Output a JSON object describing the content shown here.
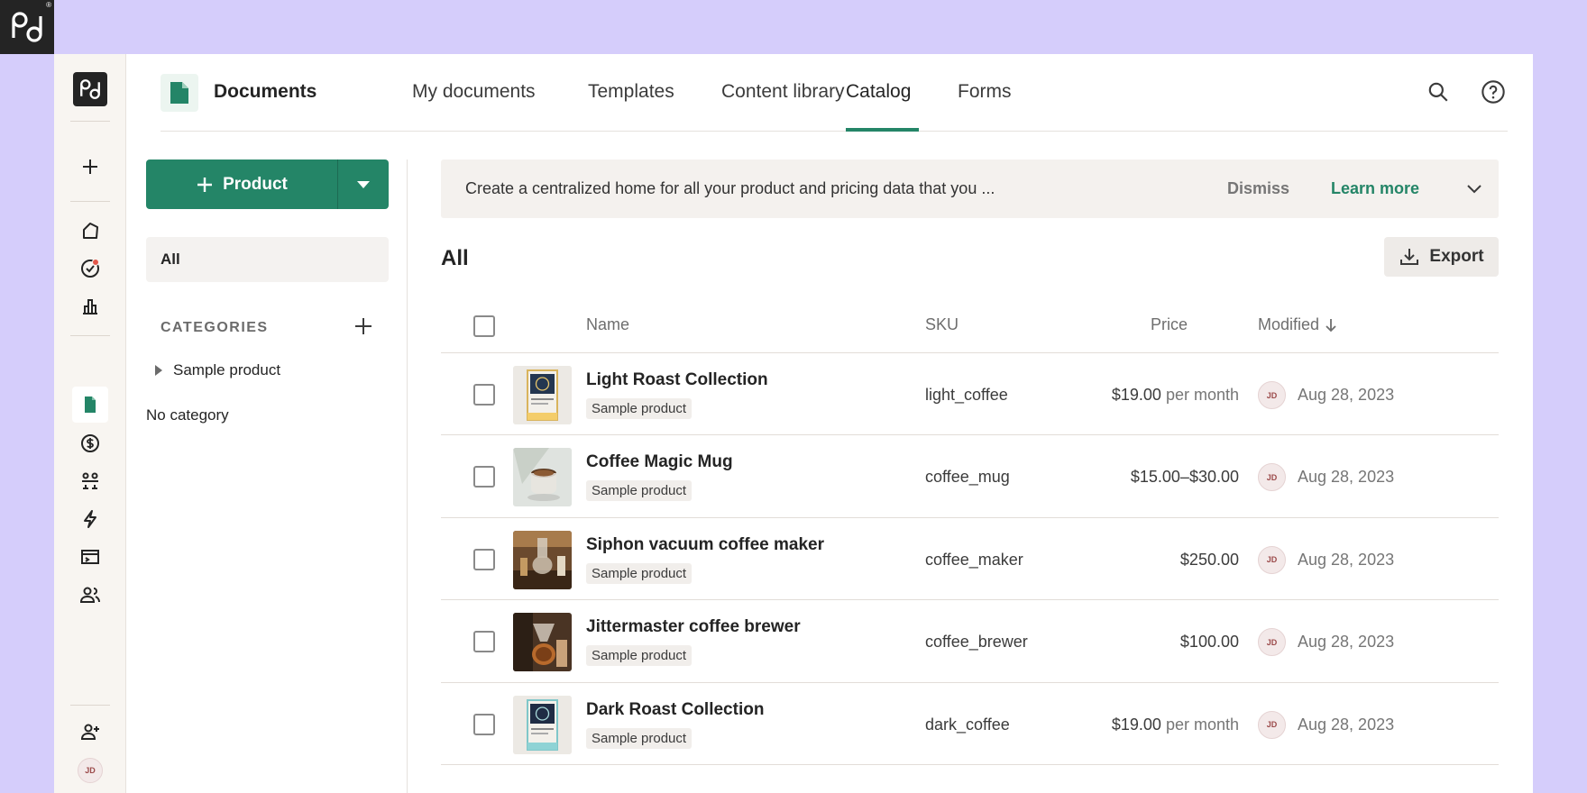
{
  "app": {
    "brand_logo": "pandadoc-logo",
    "brand_registered": "®"
  },
  "rail": {
    "items": [
      {
        "name": "create",
        "icon": "plus-icon"
      },
      {
        "name": "home",
        "icon": "home-icon"
      },
      {
        "name": "tasks",
        "icon": "check-circle-icon"
      },
      {
        "name": "reports",
        "icon": "bar-chart-icon"
      },
      {
        "name": "documents",
        "icon": "document-icon",
        "active": true
      },
      {
        "name": "payments",
        "icon": "dollar-icon"
      },
      {
        "name": "workflows",
        "icon": "people-flow-icon"
      },
      {
        "name": "automations",
        "icon": "lightning-icon"
      },
      {
        "name": "forms",
        "icon": "form-icon"
      },
      {
        "name": "contacts",
        "icon": "contacts-icon"
      },
      {
        "name": "invite",
        "icon": "add-user-icon"
      }
    ],
    "avatar_initials": "JD"
  },
  "topnav": {
    "title": "Documents",
    "tabs": [
      "My documents",
      "Templates",
      "Content library",
      "Catalog",
      "Forms"
    ],
    "active_tab": "Catalog"
  },
  "left_panel": {
    "add_button_label": "Product",
    "all_label": "All",
    "categories_label": "CATEGORIES",
    "category_items": [
      "Sample product"
    ],
    "no_category_label": "No category"
  },
  "banner": {
    "text": "Create a centralized home for all your product and pricing data that you ...",
    "dismiss": "Dismiss",
    "learn_more": "Learn more"
  },
  "main": {
    "title": "All",
    "export_label": "Export"
  },
  "table": {
    "headers": {
      "name": "Name",
      "sku": "SKU",
      "price": "Price",
      "modified": "Modified"
    },
    "rows": [
      {
        "name": "Light Roast Collection",
        "tag": "Sample product",
        "sku": "light_coffee",
        "price": "$19.00",
        "period": "per month",
        "avatar": "JD",
        "modified": "Aug 28, 2023",
        "thumb": "light-roast-bag"
      },
      {
        "name": "Coffee Magic Mug",
        "tag": "Sample product",
        "sku": "coffee_mug",
        "price": "$15.00–$30.00",
        "period": "",
        "avatar": "JD",
        "modified": "Aug 28, 2023",
        "thumb": "mug"
      },
      {
        "name": "Siphon vacuum coffee maker",
        "tag": "Sample product",
        "sku": "coffee_maker",
        "price": "$250.00",
        "period": "",
        "avatar": "JD",
        "modified": "Aug 28, 2023",
        "thumb": "siphon"
      },
      {
        "name": "Jittermaster coffee brewer",
        "tag": "Sample product",
        "sku": "coffee_brewer",
        "price": "$100.00",
        "period": "",
        "avatar": "JD",
        "modified": "Aug 28, 2023",
        "thumb": "brewer"
      },
      {
        "name": "Dark Roast Collection",
        "tag": "Sample product",
        "sku": "dark_coffee",
        "price": "$19.00",
        "period": "per month",
        "avatar": "JD",
        "modified": "Aug 28, 2023",
        "thumb": "dark-roast-bag"
      }
    ]
  },
  "colors": {
    "accent": "#248567",
    "background": "#d5cdfb",
    "rail": "#f8f5f1"
  }
}
